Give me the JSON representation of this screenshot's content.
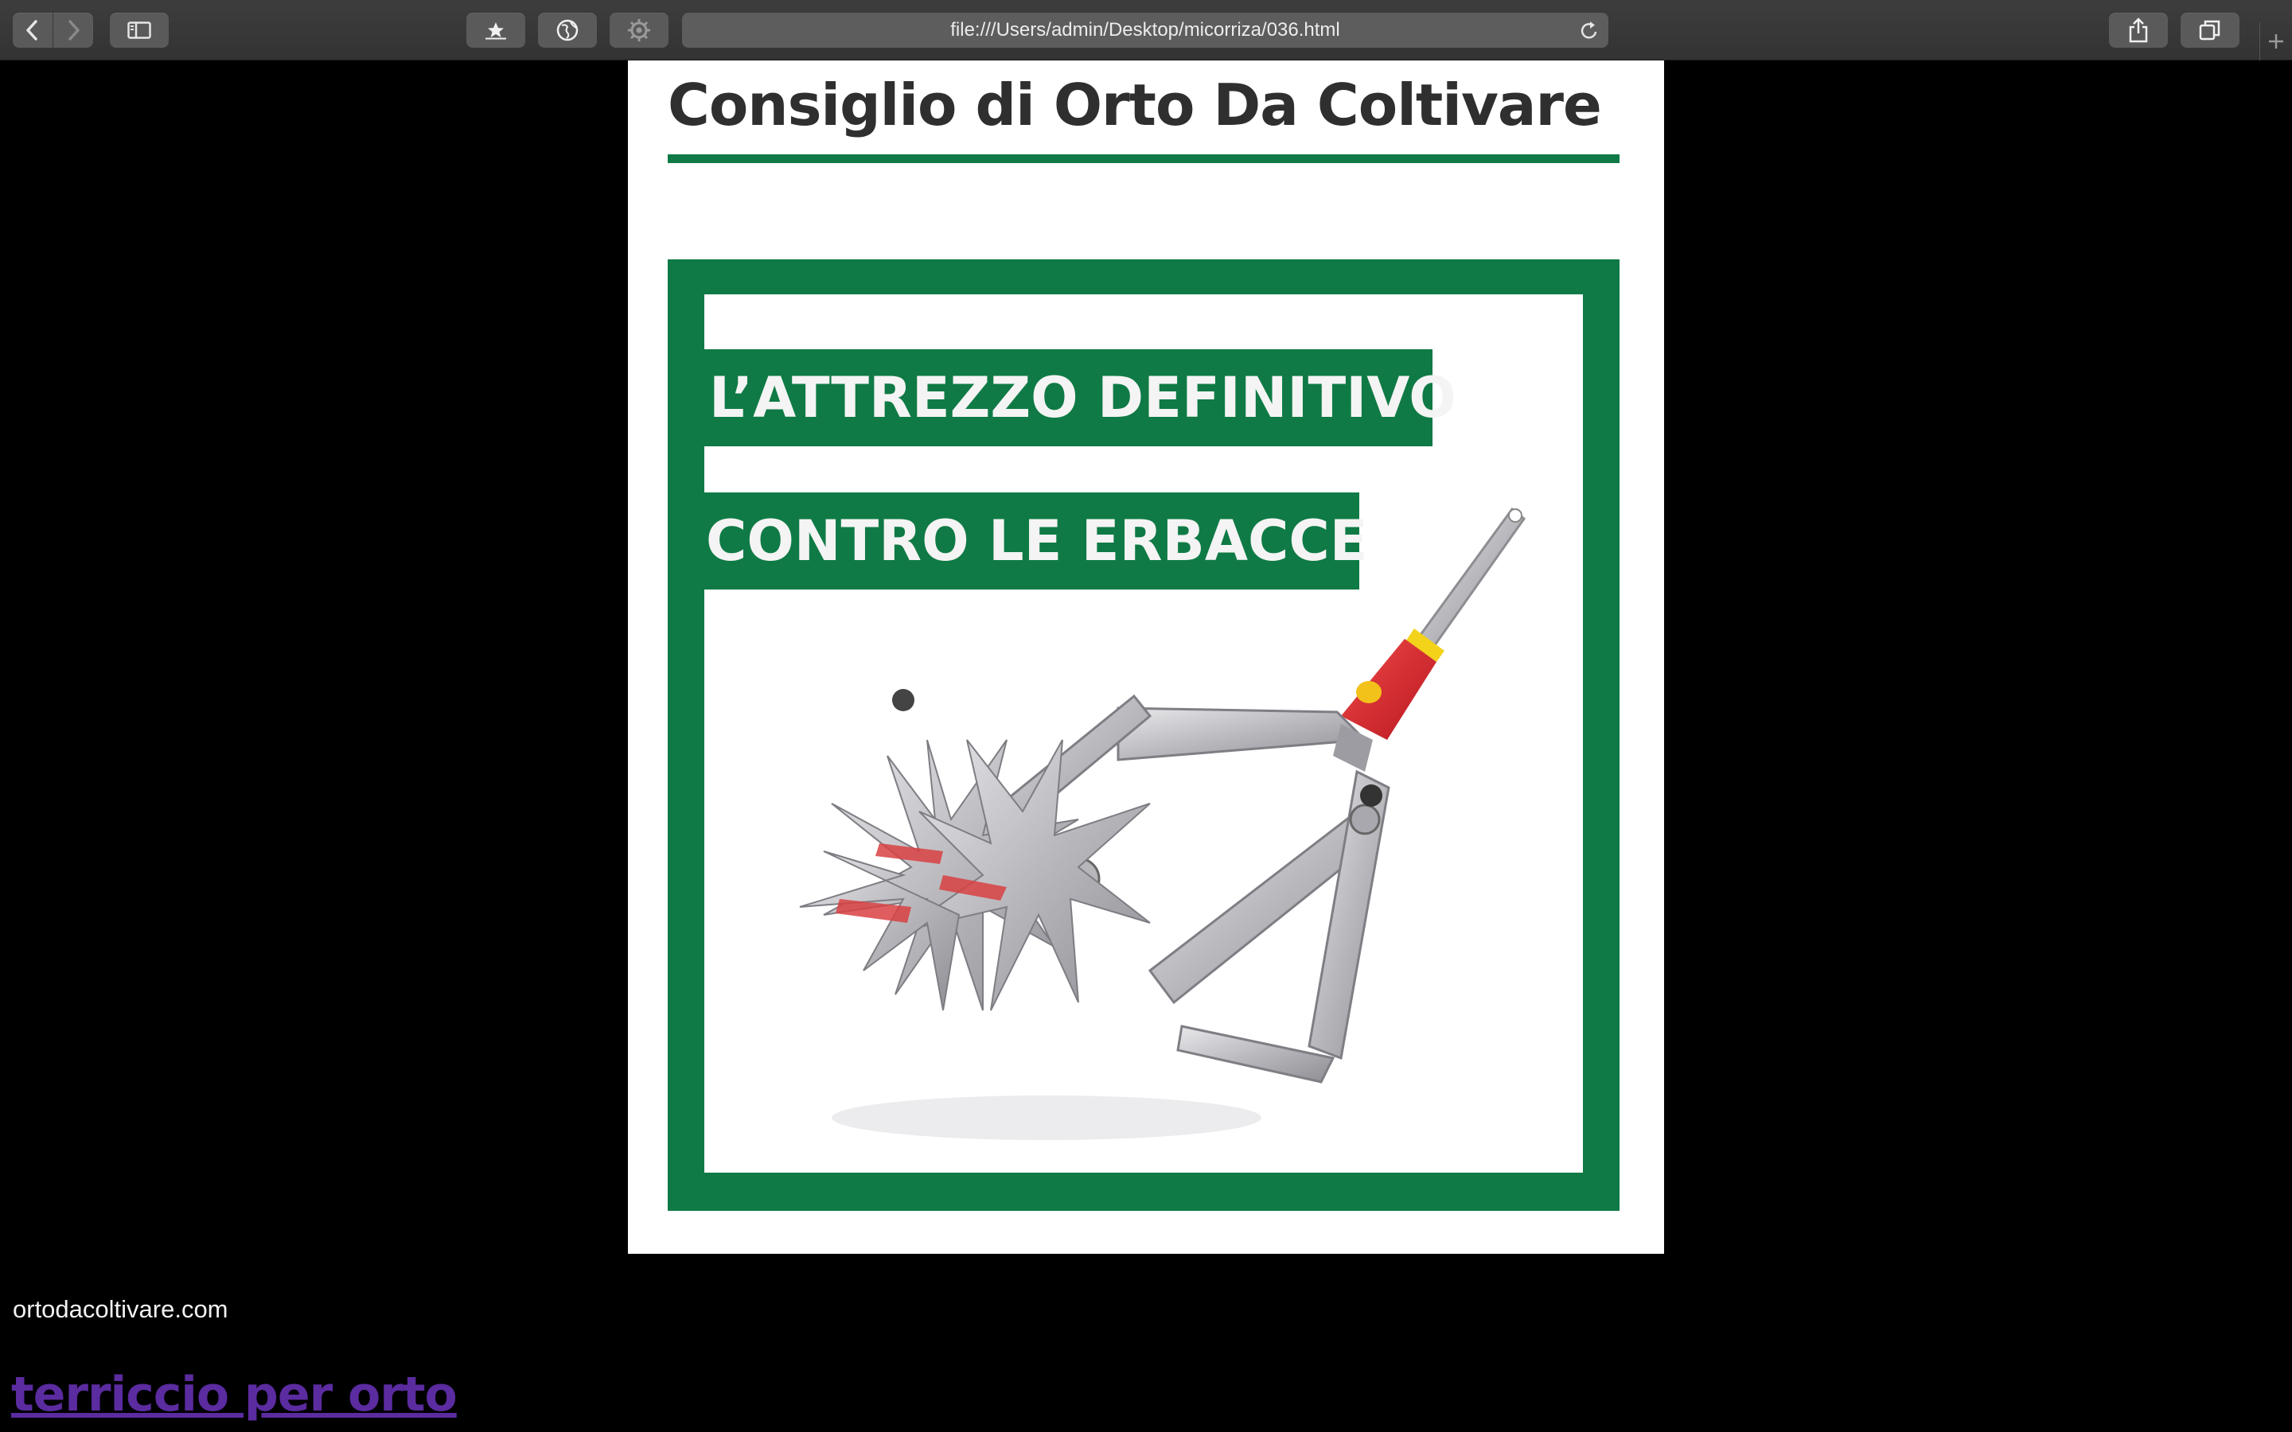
{
  "browser": {
    "url": "file:///Users/admin/Desktop/micorriza/036.html",
    "icons": [
      "back-icon",
      "forward-icon",
      "sidebar-icon",
      "bookmark-star-icon",
      "globe-icon",
      "gear-icon",
      "reload-icon",
      "share-icon",
      "tabs-icon",
      "plus-icon"
    ]
  },
  "page": {
    "title": "Consiglio di Orto Da Coltivare",
    "promo": {
      "line1": "L’ATTREZZO DEFINITIVO",
      "line2": "CONTRO LE ERBACCE"
    }
  },
  "footer": {
    "site": "ortodacoltivare.com",
    "link": "terriccio per orto"
  },
  "colors": {
    "brand_green": "#0f7a45",
    "link_visited": "#5b2ba0"
  }
}
